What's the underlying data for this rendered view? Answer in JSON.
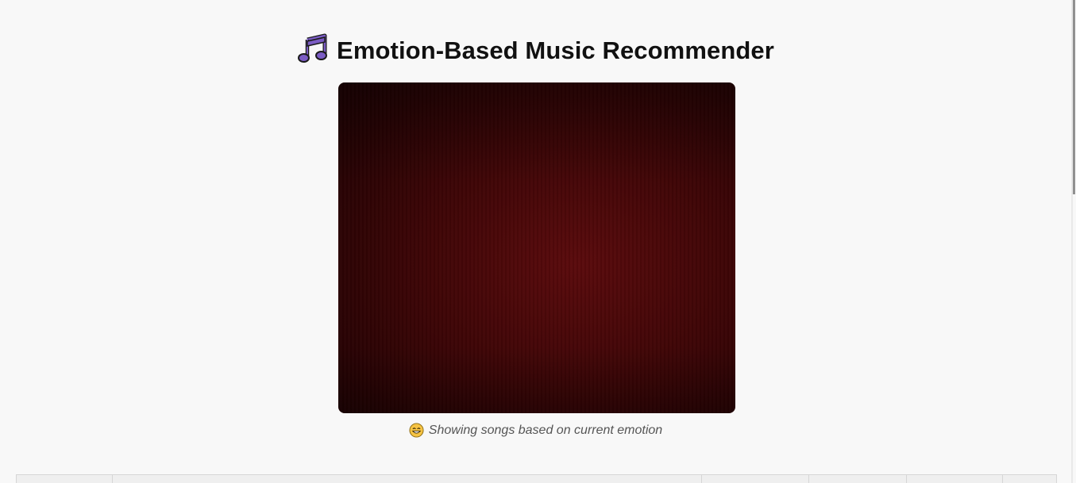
{
  "header": {
    "title": "Emotion-Based Music Recommender",
    "icon": "music-notes-icon",
    "icon_color": "#7b5cc4"
  },
  "camera": {
    "feed": "webcam-video-feed"
  },
  "status": {
    "icon": "grinning-face-icon",
    "text": "Showing songs based on current emotion"
  },
  "table": {
    "columns": [
      "",
      "",
      "",
      "",
      "",
      ""
    ]
  }
}
